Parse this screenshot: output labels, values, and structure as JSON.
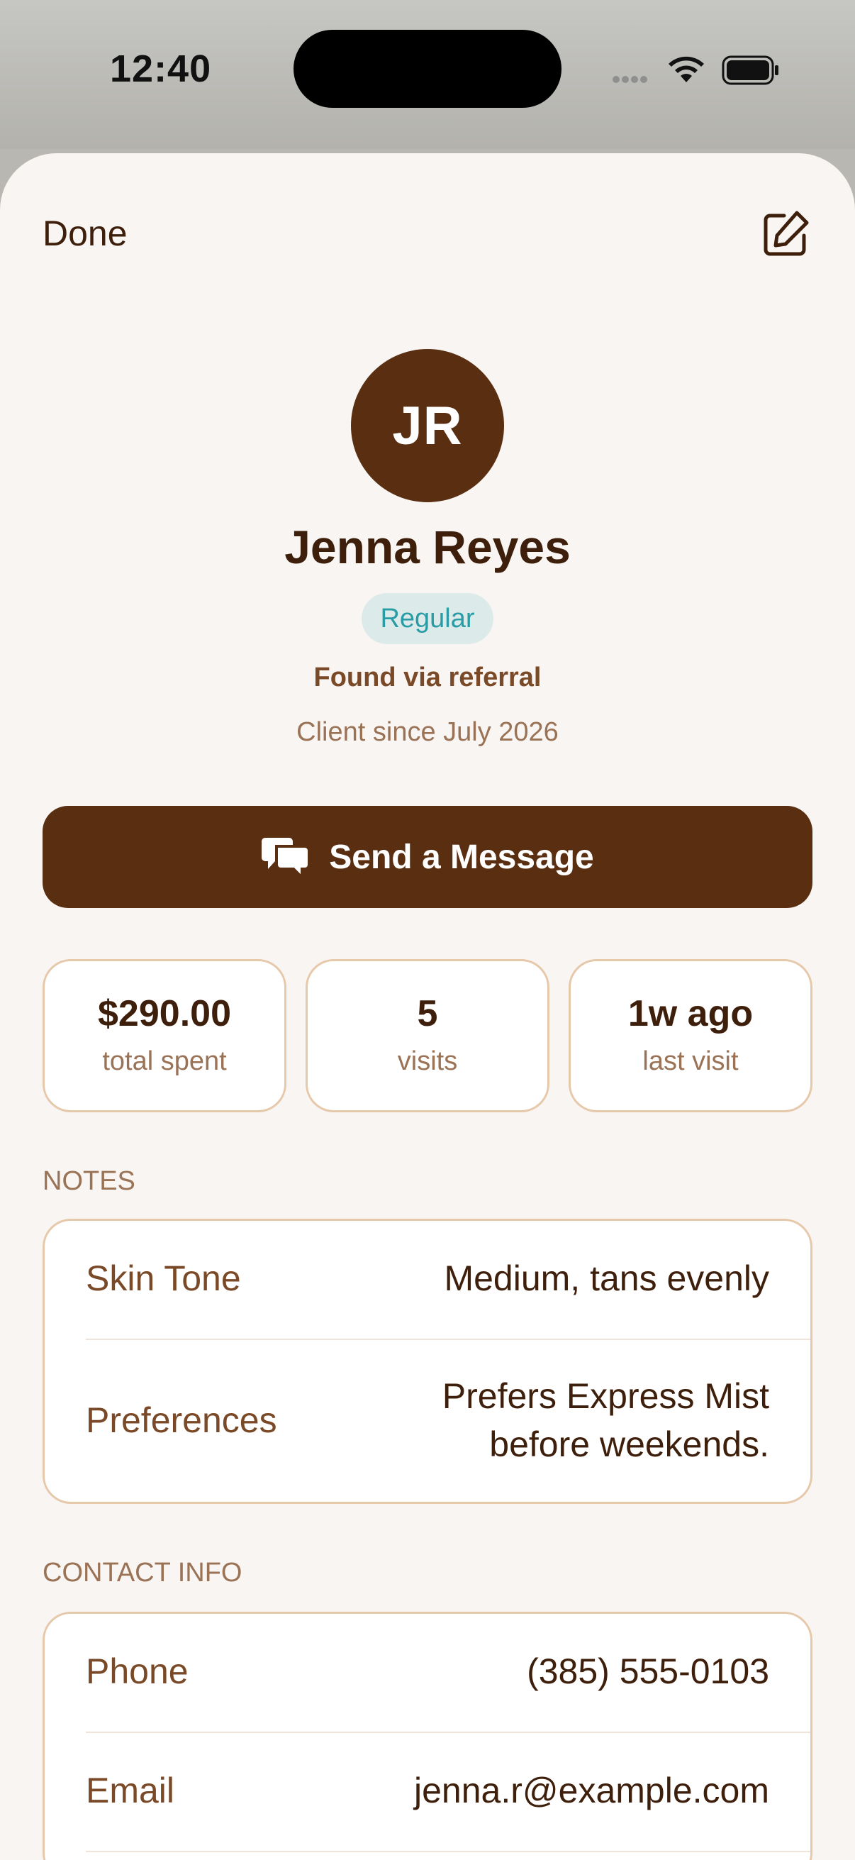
{
  "status_bar": {
    "time": "12:40"
  },
  "header": {
    "done_label": "Done"
  },
  "profile": {
    "initials": "JR",
    "name": "Jenna Reyes",
    "tag": "Regular",
    "source": "Found via referral",
    "since": "Client since July 2026"
  },
  "message_button": {
    "label": "Send a Message"
  },
  "stats": [
    {
      "value": "$290.00",
      "label": "total spent"
    },
    {
      "value": "5",
      "label": "visits"
    },
    {
      "value": "1w ago",
      "label": "last visit"
    }
  ],
  "notes": {
    "title": "NOTES",
    "rows": [
      {
        "label": "Skin Tone",
        "value": "Medium, tans evenly"
      },
      {
        "label": "Preferences",
        "value_line1": "Prefers Express Mist",
        "value_line2": "before weekends."
      }
    ]
  },
  "contact": {
    "title": "CONTACT INFO",
    "rows": [
      {
        "label": "Phone",
        "value": "(385) 555-0103"
      },
      {
        "label": "Email",
        "value": "jenna.r@example.com"
      }
    ]
  },
  "colors": {
    "brand_brown": "#5a2e10",
    "tag_teal": "#2a9ca5",
    "tag_bg": "#dcebea",
    "card_border": "#e6c8ab",
    "sheet_bg": "#f9f5f2"
  },
  "icons": {
    "edit": "pencil-square-icon",
    "message": "chat-bubbles-icon",
    "wifi": "wifi-icon",
    "battery": "battery-icon",
    "signal": "cellular-signal-icon"
  }
}
